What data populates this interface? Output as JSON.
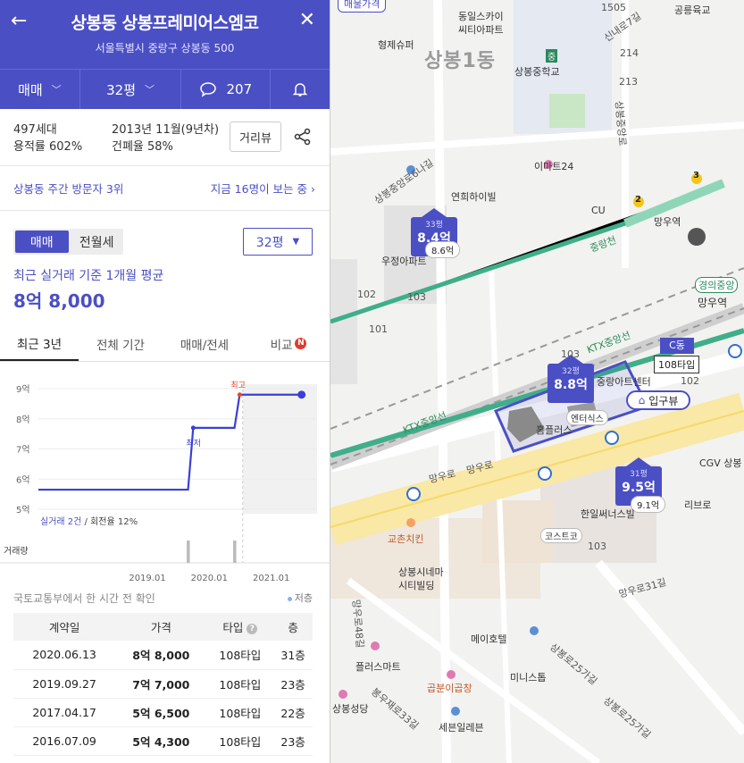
{
  "header": {
    "title": "상봉동 상봉프레미어스엠코",
    "address": "서울특별시 중랑구 상봉동 500",
    "back_icon": "←",
    "close_icon": "✕"
  },
  "tabs": {
    "trade_type": "매매",
    "size": "32평",
    "comments": "207"
  },
  "info": {
    "households": "497세대",
    "floor_area_ratio": "용적률 602%",
    "built": "2013년 11월(9년차)",
    "coverage_ratio": "건폐율 58%",
    "road_view": "거리뷰"
  },
  "visit": {
    "rank": "상봉동 주간 방문자 3위",
    "viewers": "지금 16명이 보는 중 ›"
  },
  "price_tabs": [
    "매매",
    "전월세"
  ],
  "size_select": "32평",
  "avg": {
    "label": "최근 실거래 기준 1개월 평균",
    "value": "8억 8,000"
  },
  "range_tabs": [
    "최근 3년",
    "전체 기간",
    "매매/전세",
    "비교"
  ],
  "range_badge": "N",
  "chart_data": {
    "type": "line",
    "y_tick_labels": [
      "9억",
      "8억",
      "7억",
      "6억",
      "5억"
    ],
    "ylim": [
      5,
      9
    ],
    "x_tick_labels": [
      "2019.01",
      "2020.01",
      "2021.01"
    ],
    "series": [
      {
        "x": [
          "2017.04",
          "2019.09",
          "2019.10",
          "2020.06",
          "2020.07",
          "2021.07"
        ],
        "y": [
          5.65,
          5.65,
          7.7,
          7.7,
          8.8,
          8.8
        ]
      }
    ],
    "annotations": {
      "high": "최고",
      "low": "최저"
    },
    "footer": "실거래 2건",
    "footer_rate": " / 회전율 12%",
    "volume_label": "거래량",
    "colors": {
      "line": "#3b3fd8",
      "high": "#e8472b"
    }
  },
  "source_note": "국토교통부에서 한 시간 전 확인",
  "low_floor": "저층",
  "deals": {
    "headers": [
      "계약일",
      "가격",
      "타입",
      "층"
    ],
    "rows": [
      [
        "2020.06.13",
        "8억 8,000",
        "108타입",
        "31층"
      ],
      [
        "2019.09.27",
        "7억 7,000",
        "108타입",
        "23층"
      ],
      [
        "2017.04.17",
        "5억 6,500",
        "108타입",
        "22층"
      ],
      [
        "2016.07.09",
        "5억 4,300",
        "108타입",
        "23층"
      ]
    ]
  },
  "map": {
    "top_button": "매물가격",
    "district": "상봉1동",
    "bubbles": [
      {
        "py": "33평",
        "pr": "8.4억",
        "sub": "8.6억"
      },
      {
        "py": "32평",
        "pr": "8.8억"
      },
      {
        "py": "31평",
        "pr": "9.5억",
        "sub": "9.1억"
      }
    ],
    "c_dong": "C동",
    "type_tag": "108타입",
    "entrance": "입구뷰",
    "labels": [
      "동일스카이",
      "씨티아파트",
      "형제슈퍼",
      "상봉중학교",
      "이마트24",
      "연희하이빌",
      "우정아파트",
      "CU",
      "망우역",
      "경의중앙",
      "망우역",
      "중랑아트센터",
      "엔터식스",
      "홈플러스",
      "코스트코",
      "한일써너스빌",
      "CGV 상봉",
      "리브로",
      "교촌치킨",
      "상봉시네마",
      "시티빌딩",
      "메이호텔",
      "플러스마트",
      "미니스톱",
      "곱분이곱창",
      "세븐일레븐",
      "상봉성당",
      "공릉육교",
      "신내로7길",
      "망우로",
      "망우로",
      "KTX중앙선",
      "KTX중앙선",
      "중랑천",
      "망우로31길",
      "상봉로25가길",
      "봉우재로33길",
      "상봉중앙로",
      "상봉중앙로6나길",
      "망우로48길",
      "상봉로25가길"
    ],
    "numbers": [
      "1505",
      "214",
      "213",
      "102",
      "103",
      "101",
      "103",
      "103",
      "102",
      "3",
      "2",
      "중"
    ]
  }
}
